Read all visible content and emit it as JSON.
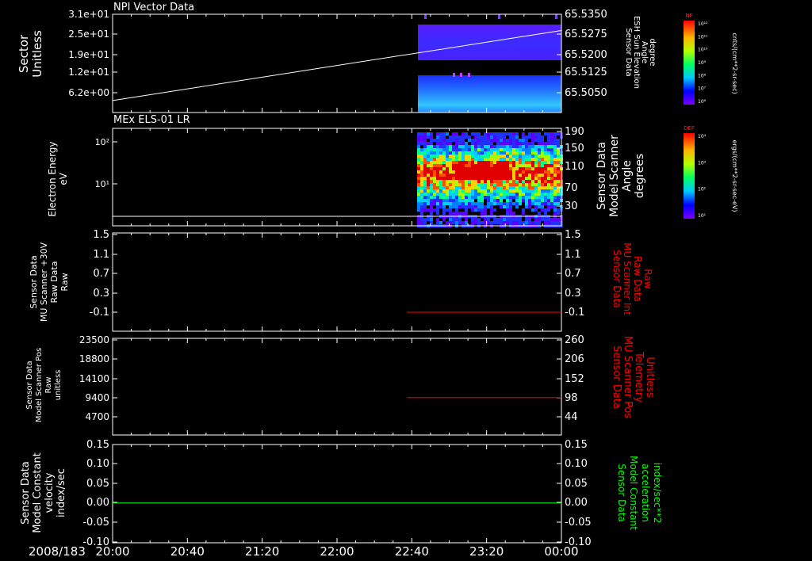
{
  "chart_data": {
    "type": "multi-panel",
    "x_axis": {
      "date_label": "2008/183",
      "ticks": [
        "20:00",
        "20:40",
        "21:20",
        "22:00",
        "22:40",
        "23:20",
        "00:00"
      ],
      "start": "20:00",
      "end": "00:00",
      "data_start": "22:40"
    },
    "panels": [
      {
        "id": "npi",
        "type": "heatmap+line",
        "title": "NPI Vector Data",
        "left_label": [
          "Sector",
          "Unitless"
        ],
        "left_ticks": [
          "3.1e+01",
          "2.5e+01",
          "1.9e+01",
          "1.2e+01",
          "6.2e+00"
        ],
        "right_label": [
          "Sensor Data",
          "ESH Sun Elevation",
          "Angle",
          "degree"
        ],
        "right_ticks": [
          "65.5350",
          "65.5275",
          "65.5200",
          "65.5125",
          "65.5050"
        ],
        "line": {
          "color": "#ffffff",
          "start": 65.502,
          "end": 65.5288
        },
        "colorbar": {
          "title": "NF",
          "units": "cnts/(cm**2-sr-sec)",
          "ticks": [
            "10¹²",
            "10¹¹",
            "10¹⁰",
            "10⁹",
            "10⁸",
            "10⁷",
            "10⁶"
          ]
        }
      },
      {
        "id": "els",
        "type": "heatmap+line",
        "title": "MEx ELS-01 LR",
        "left_label": [
          "Electron Energy",
          "eV"
        ],
        "left_ticks": [
          "10²",
          "10¹"
        ],
        "right_label": [
          "Sensor Data",
          "Model Scanner",
          "Angle",
          "degrees"
        ],
        "right_ticks": [
          "190",
          "150",
          "110",
          "70",
          "30"
        ],
        "line": {
          "color": "#ffffff",
          "value": 12,
          "unit": "degrees"
        },
        "colorbar": {
          "title": "DEF",
          "units": "ergs/(cm**2-sr-sec-eV)",
          "ticks": [
            "10⁴",
            "10³",
            "10²",
            "10¹"
          ]
        }
      },
      {
        "id": "mu_raw",
        "type": "line",
        "left_label": [
          "Sensor Data",
          "MU Scanner +30V",
          "Raw Data",
          "Raw"
        ],
        "left_ticks": [
          "1.5",
          "1.1",
          "0.7",
          "0.3",
          "-0.1"
        ],
        "left_range": [
          -0.3,
          1.5
        ],
        "right_label": [
          "Sensor Data",
          "MU Scanner Int",
          "Raw Data",
          "Raw"
        ],
        "right_label_color": "#ff0000",
        "right_ticks": [
          "1.5",
          "1.1",
          "0.7",
          "0.3",
          "-0.1"
        ],
        "line": {
          "color": "#ff0000",
          "value": -0.1
        }
      },
      {
        "id": "scanner_pos",
        "type": "line",
        "left_label": [
          "Sensor Data",
          "Model Scanner Pos",
          "Raw",
          "unitless"
        ],
        "left_ticks": [
          "23500",
          "18800",
          "14100",
          "9400",
          "4700"
        ],
        "right_label": [
          "Sensor Data",
          "MU Scanner Pos",
          "Telemetry",
          "Unitless"
        ],
        "right_label_color": "#ff0000",
        "right_ticks": [
          "260",
          "206",
          "152",
          "98",
          "44"
        ],
        "right_range": [
          0,
          260
        ],
        "line": {
          "color": "#ff0000",
          "value": 98
        }
      },
      {
        "id": "velocity",
        "type": "line",
        "left_label": [
          "Sensor Data",
          "Model Constant",
          "velocity",
          "index/sec"
        ],
        "left_ticks": [
          "0.15",
          "0.10",
          "0.05",
          "0.00",
          "-0.05",
          "-0.10"
        ],
        "left_range": [
          -0.1,
          0.15
        ],
        "right_label": [
          "Sensor Data",
          "Model Constant",
          "acceleration",
          "index/sec**2"
        ],
        "right_label_color": "#00ff00",
        "right_ticks": [
          "0.15",
          "0.10",
          "0.05",
          "0.00",
          "-0.05",
          "-0.10"
        ],
        "line": {
          "color": "#00ff00",
          "value": 0.0
        }
      }
    ]
  }
}
